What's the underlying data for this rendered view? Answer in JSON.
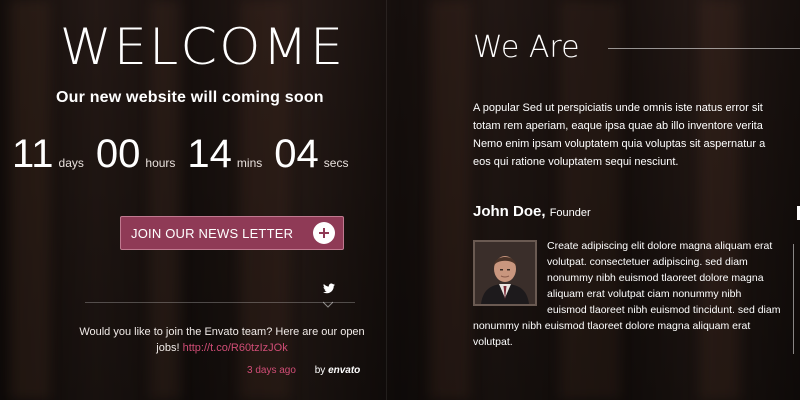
{
  "hero": {
    "title": "WELCOME",
    "subtitle": "Our new website will coming soon"
  },
  "countdown": [
    {
      "value": "11",
      "unit": "days"
    },
    {
      "value": "00",
      "unit": "hours"
    },
    {
      "value": "14",
      "unit": "mins"
    },
    {
      "value": "04",
      "unit": "secs"
    }
  ],
  "newsletter": {
    "label": "JOIN OUR NEWS LETTER",
    "icon": "plus-circle-icon"
  },
  "tweet": {
    "icon": "twitter-icon",
    "text": "Would you like to join the Envato team? Here are our open jobs!",
    "link": "http://t.co/R60tzIzJOk",
    "time": "3 days ago",
    "by_prefix": "by",
    "by_name": "envato"
  },
  "about": {
    "heading": "We Are",
    "lines": [
      "A popular Sed ut perspiciatis unde omnis iste natus error sit",
      "totam rem aperiam, eaque ipsa quae ab illo inventore verita",
      "Nemo enim ipsam voluptatem quia voluptas sit aspernatur a",
      "eos qui ratione voluptatem sequi nesciunt."
    ]
  },
  "team": {
    "member": {
      "name": "John Doe,",
      "role": "Founder",
      "bio": "Create adipiscing elit dolore magna aliquam erat volutpat. consectetuer adipiscing. sed diam nonummy nibh euismod tlaoreet dolore magna aliquam erat volutpat ciam nonummy nibh euismod tlaoreet nibh euismod tincidunt. sed diam nonummy nibh euismod tlaoreet dolore magna aliquam erat volutpat."
    }
  },
  "colors": {
    "accent": "#8f3a56",
    "link": "#d04d76",
    "background": "#241915"
  }
}
